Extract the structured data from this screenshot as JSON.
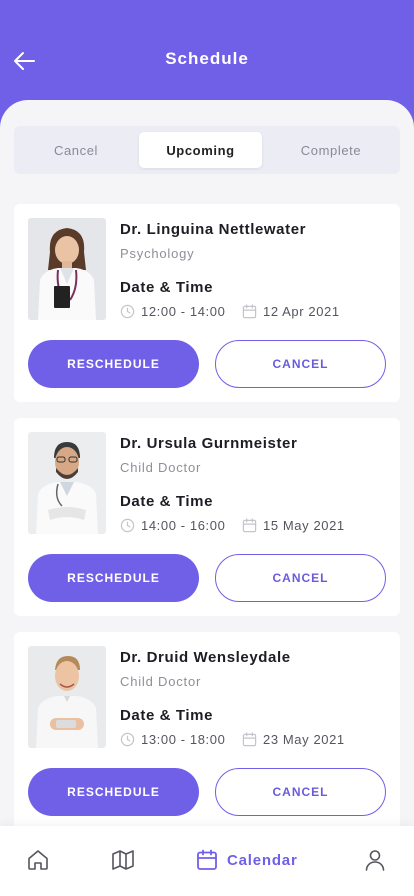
{
  "header": {
    "title": "Schedule"
  },
  "tabs": [
    {
      "label": "Cancel"
    },
    {
      "label": "Upcoming"
    },
    {
      "label": "Complete"
    }
  ],
  "appointments": [
    {
      "name": "Dr. Linguina Nettlewater",
      "specialty": "Psychology",
      "date_time_label": "Date & Time",
      "time": "12:00 - 14:00",
      "date": "12 Apr 2021",
      "reschedule_label": "RESCHEDULE",
      "cancel_label": "CANCEL"
    },
    {
      "name": "Dr. Ursula Gurnmeister",
      "specialty": "Child Doctor",
      "date_time_label": "Date & Time",
      "time": "14:00 - 16:00",
      "date": "15 May 2021",
      "reschedule_label": "RESCHEDULE",
      "cancel_label": "CANCEL"
    },
    {
      "name": "Dr. Druid Wensleydale",
      "specialty": "Child Doctor",
      "date_time_label": "Date & Time",
      "time": "13:00 - 18:00",
      "date": "23 May 2021",
      "reschedule_label": "RESCHEDULE",
      "cancel_label": "CANCEL"
    }
  ],
  "bottom_nav": {
    "items": [
      {
        "icon": "home-icon"
      },
      {
        "icon": "map-icon"
      },
      {
        "icon": "calendar-icon",
        "label": "Calendar"
      },
      {
        "icon": "user-icon"
      }
    ]
  },
  "colors": {
    "accent": "#7060E8",
    "background": "#F5F5F7",
    "text": "#1D1D24",
    "muted": "#8F8F99"
  }
}
